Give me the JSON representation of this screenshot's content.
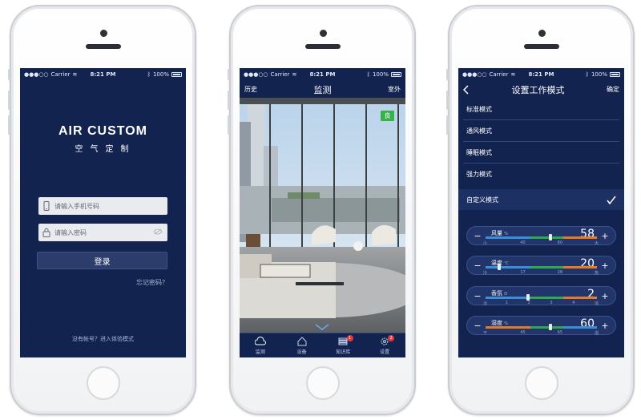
{
  "status_bar": {
    "carrier": "Carrier",
    "time": "8:21 PM",
    "battery": "100%"
  },
  "login_screen": {
    "brand": "AIR CUSTOM",
    "brand_sub": "空气定制",
    "phone_placeholder": "请输入手机号码",
    "password_placeholder": "请输入密码",
    "login_label": "登录",
    "forgot_label": "忘记密码？",
    "trial_text": "没有帐号？进入体验模式"
  },
  "monitor_screen": {
    "nav_left": "历史",
    "title": "监测",
    "nav_right": "室外",
    "air_quality": "良",
    "tabs": [
      {
        "label": "监测",
        "icon": "cloud-icon"
      },
      {
        "label": "设备",
        "icon": "house-icon"
      },
      {
        "label": "知识库",
        "icon": "books-icon",
        "badge": "1"
      },
      {
        "label": "设置",
        "icon": "gear-icon",
        "badge": "2"
      }
    ]
  },
  "mode_screen": {
    "title": "设置工作模式",
    "confirm": "确定",
    "modes": [
      "标准模式",
      "通风模式",
      "睡眠模式",
      "强力模式"
    ],
    "custom_mode": "自定义模式",
    "controls": [
      {
        "name": "风量",
        "unit": "%",
        "value": "58",
        "knob": 0.58,
        "ticks": [
          "小",
          "40",
          "60",
          "大"
        ],
        "colors": [
          "#3b8fd9",
          "#2fa84f",
          "#e87a24"
        ]
      },
      {
        "name": "温度",
        "unit": "℃",
        "value": "20",
        "knob": 0.12,
        "ticks": [
          "冷",
          "17",
          "28",
          "热"
        ],
        "colors": [
          "#3b8fd9",
          "#2fa84f",
          "#e87a24"
        ]
      },
      {
        "name": "香氛",
        "unit": "D",
        "value": "2",
        "knob": 0.38,
        "ticks": [
          "淡",
          "1",
          "2",
          "3",
          "4",
          "浓"
        ],
        "colors": [
          "#3b8fd9",
          "#2fa84f",
          "#e87a24"
        ]
      },
      {
        "name": "湿度",
        "unit": "%",
        "value": "60",
        "knob": 0.58,
        "ticks": [
          "干",
          "45",
          "65",
          "湿"
        ],
        "colors": [
          "#e87a24",
          "#2fa84f",
          "#3b8fd9"
        ]
      }
    ]
  }
}
